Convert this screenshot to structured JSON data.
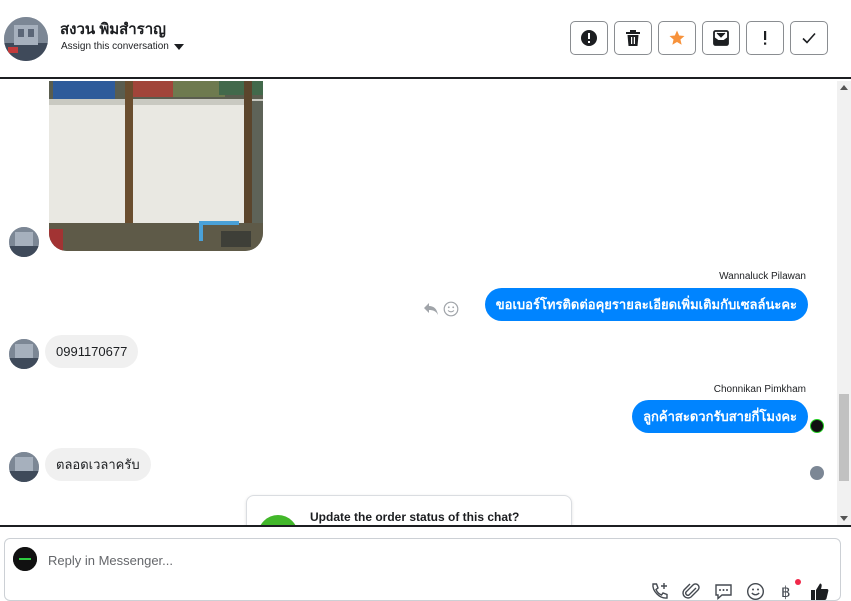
{
  "header": {
    "contact_name": "สงวน พิมสำราญ",
    "assign_label": "Assign this conversation",
    "actions": [
      {
        "name": "mark-spam-button",
        "icon": "alert-circle-icon"
      },
      {
        "name": "delete-button",
        "icon": "trash-icon"
      },
      {
        "name": "star-button",
        "icon": "star-icon"
      },
      {
        "name": "mark-unread-button",
        "icon": "envelope-icon"
      },
      {
        "name": "priority-button",
        "icon": "exclamation-icon"
      },
      {
        "name": "mark-done-button",
        "icon": "check-icon"
      }
    ]
  },
  "messages": [
    {
      "type": "image",
      "direction": "in"
    },
    {
      "type": "text",
      "direction": "out",
      "sender": "Wannaluck Pilawan",
      "text": "ขอเบอร์โทรติดต่อคุยรายละเอียดเพิ่มเติมกับเซลล์นะคะ"
    },
    {
      "type": "text",
      "direction": "in",
      "text": "0991170677"
    },
    {
      "type": "text",
      "direction": "out",
      "sender": "Chonnikan Pimkham",
      "text": "ลูกค้าสะดวกรับสายกี่โมงคะ"
    },
    {
      "type": "text",
      "direction": "in",
      "text": "ตลอดเวลาครับ"
    }
  ],
  "order_card": {
    "title": "Update the order status of this chat?"
  },
  "composer": {
    "placeholder": "Reply in Messenger..."
  },
  "colors": {
    "accent": "#0084ff",
    "incoming_bubble": "#f0f0f0",
    "star": "#f7923b",
    "badge": "#f02849",
    "order_icon": "#42b72a"
  }
}
